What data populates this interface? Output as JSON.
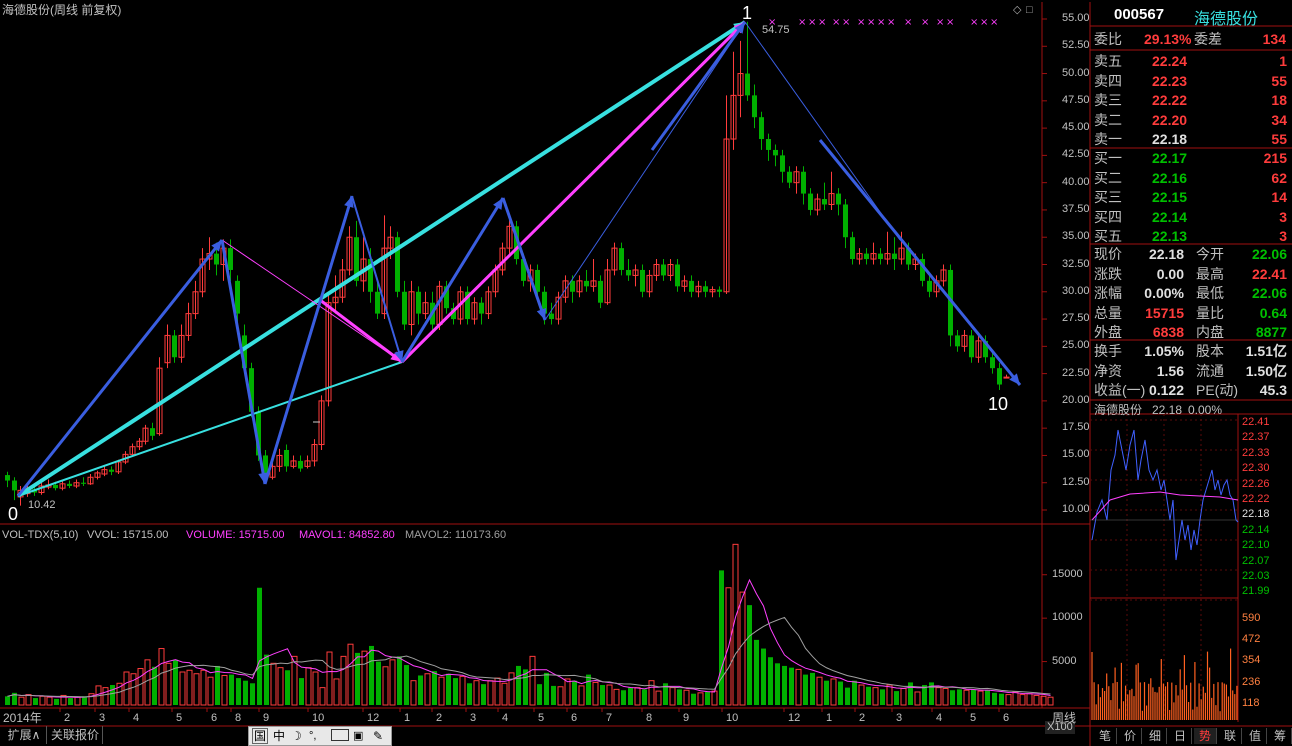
{
  "chart_title": "海德股份(周线 前复权)",
  "wave_labels": {
    "start": "0",
    "peak": "1",
    "end": "10"
  },
  "price_annotations": {
    "low": "10.42",
    "high": "54.75"
  },
  "y_axis_main": [
    "55.00",
    "52.50",
    "50.00",
    "47.50",
    "45.00",
    "42.50",
    "40.00",
    "37.50",
    "35.00",
    "32.50",
    "30.00",
    "27.50",
    "25.00",
    "22.50",
    "20.00",
    "17.50",
    "15.00",
    "12.50",
    "10.00"
  ],
  "y_axis_vol": [
    "15000",
    "10000",
    "5000"
  ],
  "vol_unit": "X100",
  "x_axis": {
    "year_label": "2014年",
    "months": [
      "2",
      "3",
      "4",
      "5",
      "6",
      "8",
      "9",
      "10",
      "12",
      "1",
      "2",
      "3",
      "4",
      "5",
      "6",
      "7",
      "8",
      "9",
      "10",
      "12",
      "1",
      "2",
      "3",
      "4",
      "5",
      "6"
    ],
    "period_label": "周线"
  },
  "volume_indicator": {
    "name": "VOL-TDX(5,10)",
    "vvol": "VVOL: 15715.00",
    "volume": "VOLUME: 15715.00",
    "mavol1": "MAVOL1: 84852.80",
    "mavol2": "MAVOL2: 110173.60"
  },
  "colors": {
    "up": "#ff3c3c",
    "down": "#00b000",
    "cyan": "#38e0e0",
    "magenta": "#ff40ff",
    "blue": "#3a5ee0",
    "text": "#c0c0c0"
  },
  "bottom_buttons": [
    "扩展∧",
    "关联报价"
  ],
  "toolbar_icons": [
    "国",
    "中",
    "moon-icon",
    "dots-icon",
    "keyboard-icon",
    "wrench-icon"
  ],
  "right_panel": {
    "code": "000567",
    "name": "海德股份",
    "weibi": {
      "label": "委比",
      "value": "29.13%",
      "label2": "委差",
      "value2": "134"
    },
    "sell": [
      {
        "label": "卖五",
        "price": "22.24",
        "vol": "1"
      },
      {
        "label": "卖四",
        "price": "22.23",
        "vol": "55"
      },
      {
        "label": "卖三",
        "price": "22.22",
        "vol": "18"
      },
      {
        "label": "卖二",
        "price": "22.20",
        "vol": "34"
      },
      {
        "label": "卖一",
        "price": "22.18",
        "vol": "55"
      }
    ],
    "buy": [
      {
        "label": "买一",
        "price": "22.17",
        "vol": "215"
      },
      {
        "label": "买二",
        "price": "22.16",
        "vol": "62"
      },
      {
        "label": "买三",
        "price": "22.15",
        "vol": "14"
      },
      {
        "label": "买四",
        "price": "22.14",
        "vol": "3"
      },
      {
        "label": "买五",
        "price": "22.13",
        "vol": "3"
      }
    ],
    "stats": [
      {
        "l1": "现价",
        "v1": "22.18",
        "l2": "今开",
        "v2": "22.06"
      },
      {
        "l1": "涨跌",
        "v1": "0.00",
        "l2": "最高",
        "v2": "22.41"
      },
      {
        "l1": "涨幅",
        "v1": "0.00%",
        "l2": "最低",
        "v2": "22.06"
      },
      {
        "l1": "总量",
        "v1": "15715",
        "l2": "量比",
        "v2": "0.64"
      },
      {
        "l1": "外盘",
        "v1": "6838",
        "l2": "内盘",
        "v2": "8877"
      }
    ],
    "stats2": [
      {
        "l1": "换手",
        "v1": "1.05%",
        "l2": "股本",
        "v2": "1.51亿"
      },
      {
        "l1": "净资",
        "v1": "1.56",
        "l2": "流通",
        "v2": "1.50亿"
      },
      {
        "l1": "收益(一)",
        "v1": "0.122",
        "l2": "PE(动)",
        "v2": "45.3"
      }
    ],
    "mini_title": "海德股份",
    "mini_price": "22.18",
    "mini_pct": "0.00%",
    "mini_price_axis": [
      "22.41",
      "22.37",
      "22.33",
      "22.30",
      "22.26",
      "22.22",
      "22.18",
      "22.14",
      "22.10",
      "22.07",
      "22.03",
      "21.99"
    ],
    "mini_vol_axis": [
      "590",
      "472",
      "354",
      "236",
      "118"
    ],
    "tabs": [
      "笔",
      "价",
      "细",
      "日",
      "势",
      "联",
      "值",
      "筹"
    ],
    "active_tab": "势"
  }
}
